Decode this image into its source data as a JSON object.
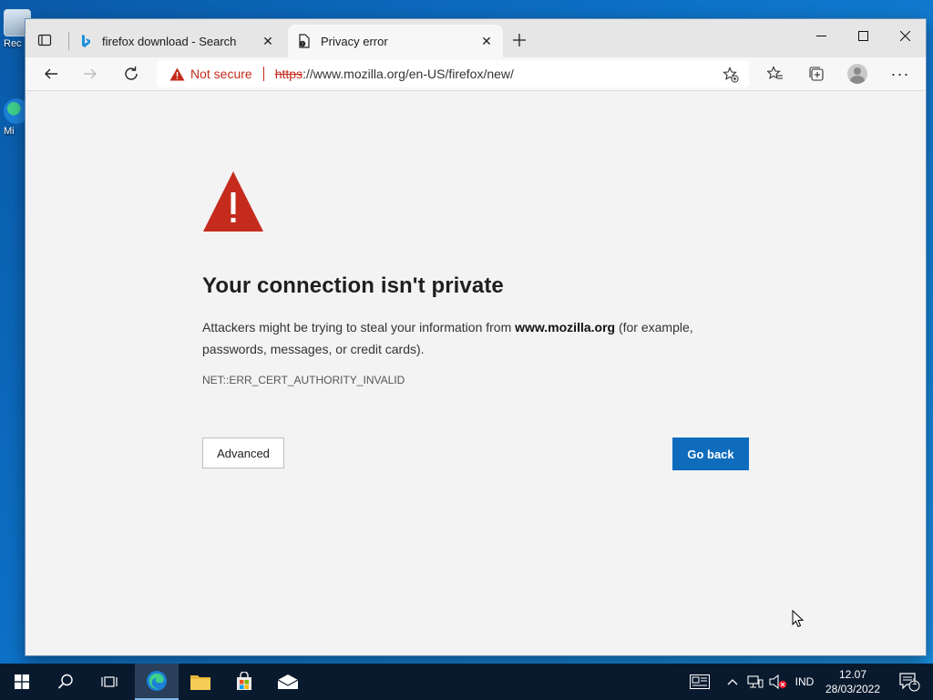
{
  "desktop": {
    "icons": [
      {
        "label": "Rec"
      },
      {
        "label": "Mi"
      }
    ]
  },
  "browser": {
    "tabs": [
      {
        "title": "firefox download - Search",
        "favicon": "bing-icon",
        "active": false
      },
      {
        "title": "Privacy error",
        "favicon": "error-document-icon",
        "active": true
      }
    ],
    "address_bar": {
      "security_status": "Not secure",
      "scheme": "https",
      "rest": "://www.mozilla.org/en-US/firefox/new/"
    }
  },
  "page": {
    "heading": "Your connection isn't private",
    "desc_before": "Attackers might be trying to steal your information from ",
    "desc_domain": "www.mozilla.org",
    "desc_after": " (for example, passwords, messages, or credit cards).",
    "error_code": "NET::ERR_CERT_AUTHORITY_INVALID",
    "advanced_label": "Advanced",
    "go_back_label": "Go back"
  },
  "taskbar": {
    "language": "IND",
    "time": "12.07",
    "date": "28/03/2022",
    "notification_count": "1"
  },
  "colors": {
    "danger": "#c42b1c",
    "primary_button": "#0f6cbd",
    "taskbar": "#0a1a2e"
  }
}
